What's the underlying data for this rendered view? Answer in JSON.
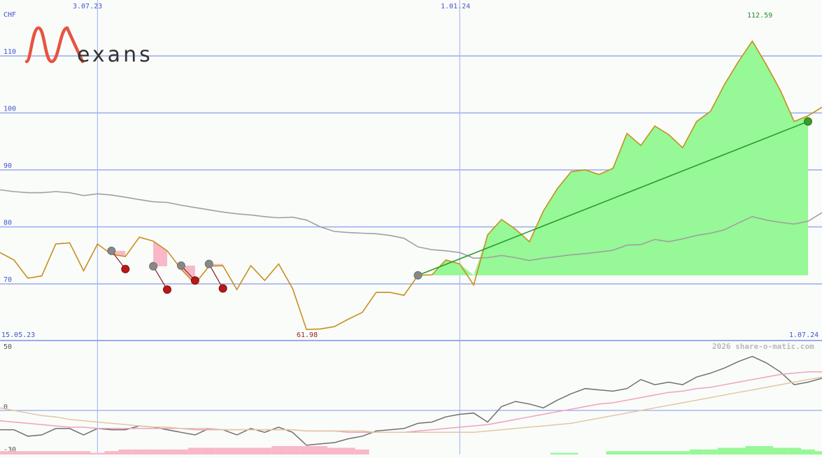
{
  "header": {
    "currency": "CHF",
    "date_labels": [
      "3.07.23",
      "1.01.24"
    ],
    "range_start": "15.05.23",
    "range_end": "1.07.24",
    "watermark": "2026 share-o-matic.com"
  },
  "logo": {
    "text": "exans",
    "color": "#e8533f"
  },
  "colors": {
    "price": "#c8901c",
    "ma": "#a0a0a0",
    "gain_fill": "#96f896",
    "loss_fill": "#f8b8c8",
    "trend": "#2a9a2a",
    "grid": "#99aaee",
    "axis_text": "#4455cc",
    "high_label": "#228822",
    "low_label": "#992222"
  },
  "chart_data": [
    {
      "type": "line",
      "yticks": [
        70,
        80,
        90,
        100,
        110
      ],
      "ylim": [
        60,
        117
      ],
      "grid": true,
      "annotations": {
        "high": "112.59",
        "low": "61.98"
      },
      "x": [
        "15.05.23",
        "22.05.23",
        "29.05.23",
        "5.06.23",
        "12.06.23",
        "19.06.23",
        "26.06.23",
        "3.07.23",
        "10.07.23",
        "17.07.23",
        "24.07.23",
        "31.07.23",
        "7.08.23",
        "14.08.23",
        "21.08.23",
        "28.08.23",
        "4.09.23",
        "11.09.23",
        "18.09.23",
        "25.09.23",
        "2.10.23",
        "9.10.23",
        "16.10.23",
        "23.10.23",
        "30.10.23",
        "6.11.23",
        "13.11.23",
        "20.11.23",
        "27.11.23",
        "4.12.23",
        "11.12.23",
        "18.12.23",
        "25.12.23",
        "1.01.24",
        "8.01.24",
        "15.01.24",
        "22.01.24",
        "29.01.24",
        "5.02.24",
        "12.02.24",
        "19.02.24",
        "26.02.24",
        "4.03.24",
        "11.03.24",
        "18.03.24",
        "25.03.24",
        "1.04.24",
        "8.04.24",
        "15.04.24",
        "22.04.24",
        "29.04.24",
        "6.05.24",
        "13.05.24",
        "20.05.24",
        "27.05.24",
        "3.06.24",
        "10.06.24",
        "17.06.24",
        "24.06.24",
        "1.07.24"
      ],
      "series": [
        {
          "role": "price",
          "values": [
            75.5,
            74.2,
            71.0,
            71.4,
            77.0,
            77.2,
            72.3,
            77.0,
            75.2,
            74.8,
            78.2,
            77.5,
            75.8,
            72.6,
            70.0,
            73.1,
            73.2,
            69.0,
            73.2,
            70.6,
            73.5,
            69.2,
            62.0,
            62.1,
            62.5,
            63.8,
            65.0,
            68.5,
            68.5,
            68.0,
            71.5,
            71.6,
            74.2,
            73.5,
            69.8,
            78.6,
            81.3,
            79.6,
            77.4,
            82.8,
            86.7,
            89.7,
            90.0,
            89.2,
            90.3,
            96.4,
            94.3,
            97.7,
            96.2,
            93.9,
            98.5,
            100.3,
            105.0,
            109.0,
            112.6,
            108.5,
            104.0,
            98.5,
            99.5,
            101.0
          ]
        },
        {
          "role": "moving_average",
          "values": [
            86.5,
            86.2,
            86.0,
            86.0,
            86.2,
            86.0,
            85.5,
            85.8,
            85.6,
            85.2,
            84.8,
            84.4,
            84.3,
            83.8,
            83.4,
            83.0,
            82.6,
            82.3,
            82.1,
            81.8,
            81.6,
            81.7,
            81.2,
            80.0,
            79.2,
            79.0,
            78.9,
            78.8,
            78.5,
            78.0,
            76.5,
            76.0,
            75.8,
            75.5,
            74.5,
            74.6,
            75.0,
            74.6,
            74.1,
            74.5,
            74.8,
            75.1,
            75.3,
            75.6,
            75.9,
            76.8,
            76.9,
            77.8,
            77.4,
            77.9,
            78.5,
            78.9,
            79.5,
            80.7,
            81.8,
            81.2,
            80.8,
            80.5,
            81.0,
            82.5
          ]
        }
      ],
      "events": {
        "sell_markers": [
          {
            "x": "17.07.23",
            "y": 72.6
          },
          {
            "x": "7.08.23",
            "y": 69.0
          },
          {
            "x": "21.08.23",
            "y": 70.6
          },
          {
            "x": "4.09.23",
            "y": 69.2
          },
          {
            "x": "1.07.24",
            "y": 98.5
          }
        ],
        "buy_markers": [
          {
            "x": "10.07.23",
            "y": 75.8
          },
          {
            "x": "31.07.23",
            "y": 73.1
          },
          {
            "x": "14.08.23",
            "y": 73.2
          },
          {
            "x": "28.08.23",
            "y": 73.5
          },
          {
            "x": "11.12.23",
            "y": 71.5
          }
        ],
        "trend_line": {
          "from": {
            "x": "11.12.23",
            "y": 71.5
          },
          "to": {
            "x": "1.07.24",
            "y": 98.5
          }
        }
      }
    },
    {
      "type": "line",
      "yticks": [
        50,
        0,
        -30
      ],
      "ylim": [
        -33,
        55
      ],
      "series": [
        {
          "role": "oscillator",
          "values": [
            -15,
            -15,
            -20,
            -19,
            -14,
            -14,
            -19,
            -14,
            -15,
            -15,
            -12,
            -13,
            -15,
            -17,
            -19,
            -14,
            -15,
            -19,
            -14,
            -17,
            -13,
            -17,
            -27,
            -26,
            -25,
            -22,
            -20,
            -16,
            -15,
            -14,
            -10,
            -9,
            -5,
            -3,
            -2,
            -9,
            3,
            7,
            5,
            2,
            8,
            13,
            17,
            16,
            15,
            17,
            24,
            20,
            22,
            20,
            26,
            29,
            33,
            38,
            42,
            37,
            30,
            20,
            22,
            25
          ]
        },
        {
          "role": "signal_pink",
          "values": [
            -8,
            -9,
            -10,
            -11,
            -12,
            -13,
            -13,
            -14,
            -14,
            -14,
            -14,
            -14,
            -14,
            -14,
            -15,
            -15,
            -15,
            -15,
            -15,
            -15,
            -15,
            -15,
            -16,
            -16,
            -16,
            -17,
            -17,
            -17,
            -17,
            -17,
            -16,
            -15,
            -14,
            -13,
            -12,
            -11,
            -9,
            -7,
            -5,
            -3,
            -1,
            1,
            3,
            5,
            6,
            8,
            10,
            12,
            14,
            15,
            17,
            18,
            20,
            22,
            24,
            26,
            28,
            29,
            30,
            30
          ]
        },
        {
          "role": "signal_tan",
          "values": [
            2,
            0,
            -2,
            -4,
            -5,
            -7,
            -8,
            -9,
            -10,
            -11,
            -12,
            -13,
            -13,
            -14,
            -14,
            -14,
            -15,
            -15,
            -15,
            -15,
            -15,
            -15,
            -16,
            -16,
            -16,
            -16,
            -16,
            -17,
            -17,
            -17,
            -17,
            -17,
            -17,
            -17,
            -17,
            -16,
            -15,
            -14,
            -13,
            -12,
            -11,
            -10,
            -8,
            -6,
            -4,
            -2,
            0,
            2,
            4,
            6,
            8,
            10,
            12,
            14,
            16,
            18,
            20,
            22,
            24,
            26
          ]
        }
      ],
      "histogram": [
        2,
        2,
        2,
        2,
        2,
        2,
        2,
        1,
        2,
        3,
        3,
        3,
        3,
        3,
        4,
        4,
        4,
        4,
        4,
        4,
        5,
        5,
        5,
        5,
        4,
        4,
        3,
        0,
        0,
        0,
        0,
        0,
        0,
        0,
        0,
        0,
        0,
        0,
        0,
        0,
        1,
        1,
        0,
        0,
        2,
        2,
        2,
        2,
        2,
        2,
        3,
        3,
        4,
        4,
        5,
        5,
        4,
        4,
        3,
        2
      ]
    }
  ]
}
